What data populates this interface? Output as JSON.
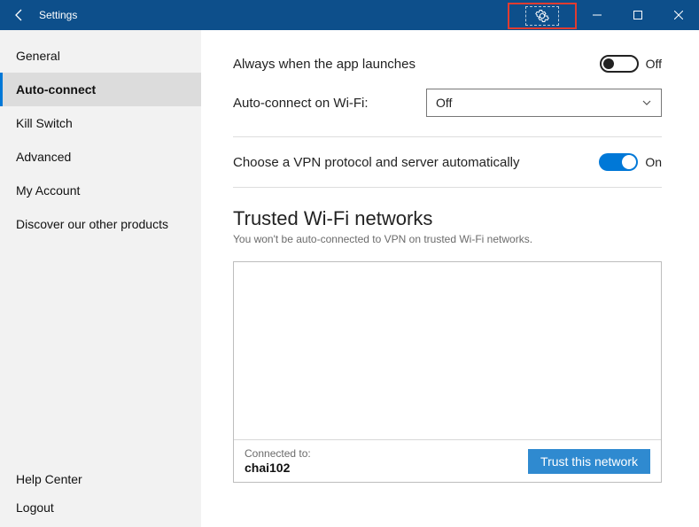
{
  "titlebar": {
    "title": "Settings"
  },
  "sidebar": {
    "items": [
      {
        "label": "General"
      },
      {
        "label": "Auto-connect"
      },
      {
        "label": "Kill Switch"
      },
      {
        "label": "Advanced"
      },
      {
        "label": "My Account"
      },
      {
        "label": "Discover our other products"
      }
    ],
    "active_index": 1,
    "bottom": [
      {
        "label": "Help Center"
      },
      {
        "label": "Logout"
      }
    ]
  },
  "content": {
    "always_launch": {
      "label": "Always when the app launches",
      "state_text": "Off",
      "state": "off"
    },
    "auto_wifi": {
      "label": "Auto-connect on Wi-Fi:",
      "value": "Off"
    },
    "auto_protocol": {
      "label": "Choose a VPN protocol and server automatically",
      "state_text": "On",
      "state": "on"
    },
    "trusted": {
      "title": "Trusted Wi-Fi networks",
      "subtitle": "You won't be auto-connected to VPN on trusted Wi-Fi networks.",
      "connected_label": "Connected to:",
      "connected_name": "chai102",
      "button": "Trust this network"
    }
  }
}
